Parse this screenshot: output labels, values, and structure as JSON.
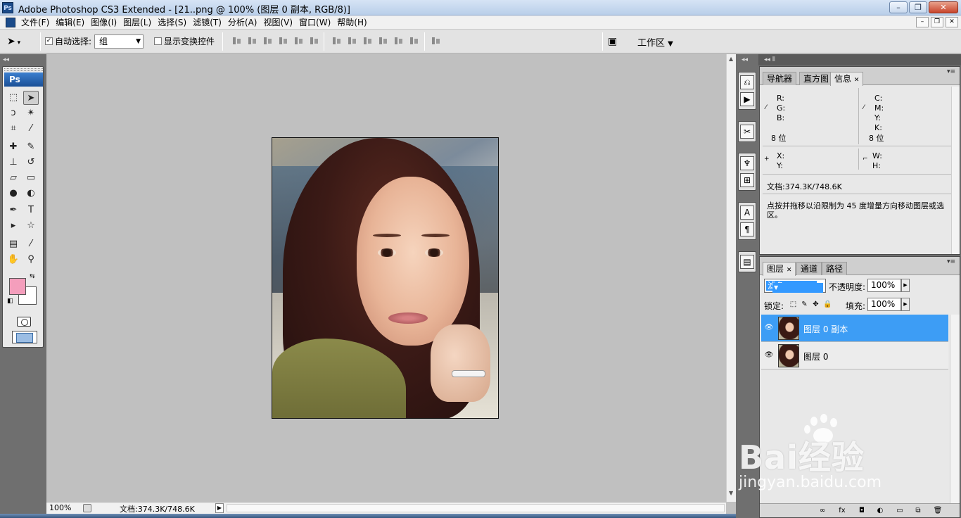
{
  "window": {
    "title": "Adobe Photoshop CS3 Extended - [21..png @ 100% (图层 0 副本, RGB/8)]",
    "app_icon": "Ps"
  },
  "menu": [
    "文件(F)",
    "编辑(E)",
    "图像(I)",
    "图层(L)",
    "选择(S)",
    "滤镜(T)",
    "分析(A)",
    "视图(V)",
    "窗口(W)",
    "帮助(H)"
  ],
  "options": {
    "auto_select_checked": true,
    "auto_select_label": "自动选择:",
    "auto_select_value": "组",
    "show_transform_checked": false,
    "show_transform_label": "显示变换控件",
    "workspace_label": "工作区"
  },
  "toolbox": {
    "badge": "Ps",
    "foreground_color": "#f49ebc",
    "background_color": "#ffffff",
    "tools": [
      {
        "name": "marquee-tool-icon",
        "glyph": "⬚"
      },
      {
        "name": "move-tool-icon",
        "glyph": "➤",
        "active": true
      },
      {
        "name": "lasso-tool-icon",
        "glyph": "ↄ"
      },
      {
        "name": "magic-wand-tool-icon",
        "glyph": "✴"
      },
      {
        "name": "crop-tool-icon",
        "glyph": "⌗"
      },
      {
        "name": "slice-tool-icon",
        "glyph": "⁄"
      },
      {
        "name": "healing-brush-tool-icon",
        "glyph": "✚"
      },
      {
        "name": "brush-tool-icon",
        "glyph": "✎"
      },
      {
        "name": "clone-stamp-tool-icon",
        "glyph": "⊥"
      },
      {
        "name": "history-brush-tool-icon",
        "glyph": "↺"
      },
      {
        "name": "eraser-tool-icon",
        "glyph": "▱"
      },
      {
        "name": "gradient-tool-icon",
        "glyph": "▭"
      },
      {
        "name": "blur-tool-icon",
        "glyph": "●"
      },
      {
        "name": "dodge-tool-icon",
        "glyph": "◐"
      },
      {
        "name": "pen-tool-icon",
        "glyph": "✒"
      },
      {
        "name": "type-tool-icon",
        "glyph": "T"
      },
      {
        "name": "path-selection-tool-icon",
        "glyph": "▸"
      },
      {
        "name": "shape-tool-icon",
        "glyph": "☆"
      },
      {
        "name": "notes-tool-icon",
        "glyph": "▤"
      },
      {
        "name": "eyedropper-tool-icon",
        "glyph": "⁄"
      },
      {
        "name": "hand-tool-icon",
        "glyph": "✋"
      },
      {
        "name": "zoom-tool-icon",
        "glyph": "⚲"
      }
    ]
  },
  "status": {
    "zoom": "100%",
    "doc_info": "文档:374.3K/748.6K"
  },
  "info_panel": {
    "tabs": [
      "导航器",
      "直方图",
      "信息"
    ],
    "active_tab": "信息",
    "rgb": {
      "r": "R:",
      "g": "G:",
      "b": "B:"
    },
    "cmyk": {
      "c": "C:",
      "m": "M:",
      "y": "Y:",
      "k": "K:"
    },
    "bit_left": "8 位",
    "bit_right": "8 位",
    "xy": {
      "x": "X:",
      "y": "Y:"
    },
    "wh": {
      "w": "W:",
      "h": "H:"
    },
    "doc": "文档:374.3K/748.6K",
    "hint": "点按并拖移以沿限制为 45 度增量方向移动图层或选区。"
  },
  "layers_panel": {
    "tabs": [
      "图层",
      "通道",
      "路径"
    ],
    "active_tab": "图层",
    "blend_mode": "滤色",
    "opacity_label": "不透明度:",
    "opacity": "100%",
    "lock_label": "锁定:",
    "fill_label": "填充:",
    "fill": "100%",
    "layers": [
      {
        "name": "图层 0 副本",
        "selected": true,
        "visible": true
      },
      {
        "name": "图层 0",
        "selected": false,
        "visible": true
      }
    ]
  },
  "watermark": {
    "brand": "Bai经验",
    "sub": "jingyan.baidu.com"
  }
}
